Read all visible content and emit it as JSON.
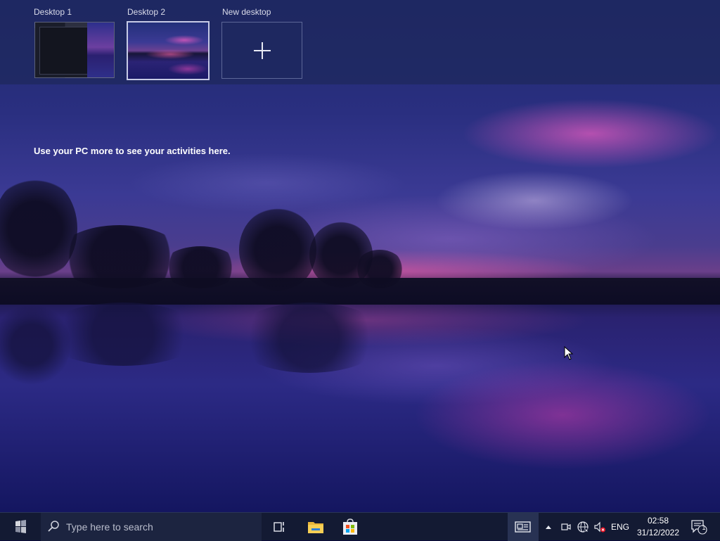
{
  "task_view": {
    "desktops": [
      {
        "label": "Desktop 1"
      },
      {
        "label": "Desktop 2",
        "active": true
      }
    ],
    "new_desktop_label": "New desktop",
    "activities_message": "Use your PC more to see your activities here."
  },
  "taskbar": {
    "search_placeholder": "Type here to search",
    "pinned_apps": [
      "task-view",
      "file-explorer",
      "microsoft-store"
    ],
    "language": "ENG",
    "time": "02:58",
    "date": "31/12/2022",
    "notification_count": "1",
    "tray_icons": [
      "news-icon",
      "chevron-up-icon",
      "meet-now-icon",
      "network-globe-icon",
      "speaker-muted-icon"
    ]
  },
  "colors": {
    "taskbar_bg": "#131a33",
    "desktops_bar_bg": "#1e285f",
    "active_border": "#c7cbe6"
  }
}
